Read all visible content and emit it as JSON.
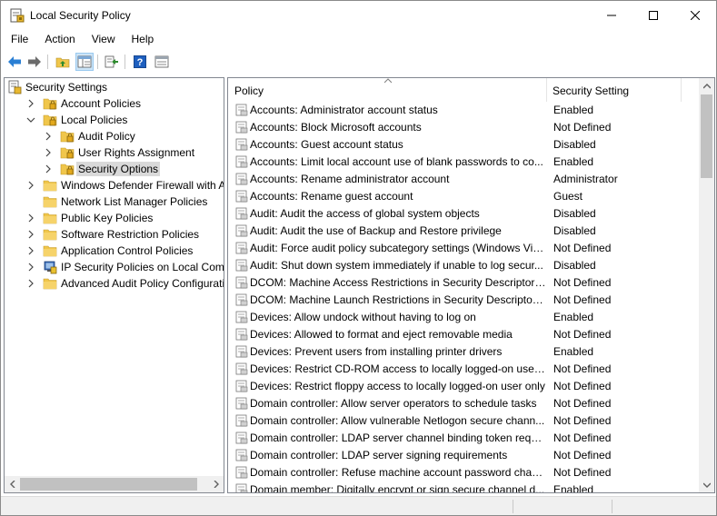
{
  "window": {
    "title": "Local Security Policy"
  },
  "menu": [
    "File",
    "Action",
    "View",
    "Help"
  ],
  "tree": [
    {
      "label": "Security Settings",
      "depth": 0,
      "chevron": "none",
      "icon": "security-settings-icon"
    },
    {
      "label": "Account Policies",
      "depth": 1,
      "chevron": "right",
      "icon": "folder-lock-icon"
    },
    {
      "label": "Local Policies",
      "depth": 1,
      "chevron": "down",
      "icon": "folder-lock-icon"
    },
    {
      "label": "Audit Policy",
      "depth": 2,
      "chevron": "right",
      "icon": "folder-lock-icon"
    },
    {
      "label": "User Rights Assignment",
      "depth": 2,
      "chevron": "right",
      "icon": "folder-lock-icon"
    },
    {
      "label": "Security Options",
      "depth": 2,
      "chevron": "right",
      "icon": "folder-lock-icon",
      "selected": true
    },
    {
      "label": "Windows Defender Firewall with Adva",
      "depth": 1,
      "chevron": "right",
      "icon": "folder-icon"
    },
    {
      "label": "Network List Manager Policies",
      "depth": 1,
      "chevron": "none",
      "icon": "folder-icon"
    },
    {
      "label": "Public Key Policies",
      "depth": 1,
      "chevron": "right",
      "icon": "folder-icon"
    },
    {
      "label": "Software Restriction Policies",
      "depth": 1,
      "chevron": "right",
      "icon": "folder-icon"
    },
    {
      "label": "Application Control Policies",
      "depth": 1,
      "chevron": "right",
      "icon": "folder-icon"
    },
    {
      "label": "IP Security Policies on Local Compute",
      "depth": 1,
      "chevron": "right",
      "icon": "ip-security-icon"
    },
    {
      "label": "Advanced Audit Policy Configuration",
      "depth": 1,
      "chevron": "right",
      "icon": "folder-icon"
    }
  ],
  "list": {
    "columns": {
      "policy": "Policy",
      "setting": "Security Setting"
    },
    "rows": [
      {
        "policy": "Accounts: Administrator account status",
        "setting": "Enabled"
      },
      {
        "policy": "Accounts: Block Microsoft accounts",
        "setting": "Not Defined"
      },
      {
        "policy": "Accounts: Guest account status",
        "setting": "Disabled"
      },
      {
        "policy": "Accounts: Limit local account use of blank passwords to co...",
        "setting": "Enabled"
      },
      {
        "policy": "Accounts: Rename administrator account",
        "setting": "Administrator"
      },
      {
        "policy": "Accounts: Rename guest account",
        "setting": "Guest"
      },
      {
        "policy": "Audit: Audit the access of global system objects",
        "setting": "Disabled"
      },
      {
        "policy": "Audit: Audit the use of Backup and Restore privilege",
        "setting": "Disabled"
      },
      {
        "policy": "Audit: Force audit policy subcategory settings (Windows Vis...",
        "setting": "Not Defined"
      },
      {
        "policy": "Audit: Shut down system immediately if unable to log secur...",
        "setting": "Disabled"
      },
      {
        "policy": "DCOM: Machine Access Restrictions in Security Descriptor D...",
        "setting": "Not Defined"
      },
      {
        "policy": "DCOM: Machine Launch Restrictions in Security Descriptor ...",
        "setting": "Not Defined"
      },
      {
        "policy": "Devices: Allow undock without having to log on",
        "setting": "Enabled"
      },
      {
        "policy": "Devices: Allowed to format and eject removable media",
        "setting": "Not Defined"
      },
      {
        "policy": "Devices: Prevent users from installing printer drivers",
        "setting": "Enabled"
      },
      {
        "policy": "Devices: Restrict CD-ROM access to locally logged-on user ...",
        "setting": "Not Defined"
      },
      {
        "policy": "Devices: Restrict floppy access to locally logged-on user only",
        "setting": "Not Defined"
      },
      {
        "policy": "Domain controller: Allow server operators to schedule tasks",
        "setting": "Not Defined"
      },
      {
        "policy": "Domain controller: Allow vulnerable Netlogon secure chann...",
        "setting": "Not Defined"
      },
      {
        "policy": "Domain controller: LDAP server channel binding token requi...",
        "setting": "Not Defined"
      },
      {
        "policy": "Domain controller: LDAP server signing requirements",
        "setting": "Not Defined"
      },
      {
        "policy": "Domain controller: Refuse machine account password chan...",
        "setting": "Not Defined"
      },
      {
        "policy": "Domain member: Digitally encrypt or sign secure channel d...",
        "setting": "Enabled"
      }
    ]
  },
  "toolbar": {
    "buttons": [
      "back-icon",
      "forward-icon",
      "up-folder-icon",
      "show-hide-tree-icon",
      "export-list-icon",
      "help-icon",
      "properties-icon"
    ]
  },
  "colors": {
    "accent": "#1e7bd4",
    "selection": "#d9d9d9",
    "folder": "#f0c64b"
  }
}
